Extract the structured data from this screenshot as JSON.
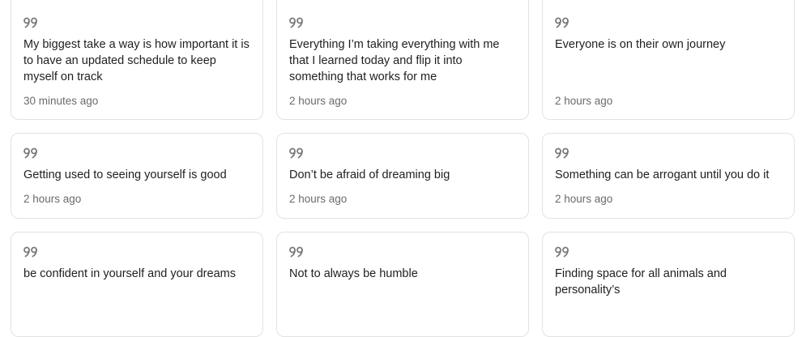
{
  "colors": {
    "card_border": "#e2e2e2",
    "text": "#1f1f1f",
    "muted": "#6b6b6b",
    "quote_icon": "#7a7a7a"
  },
  "cards": [
    {
      "icon": "quote-icon",
      "text": "My biggest take a way is how important it is to have an updated schedule to keep myself on track",
      "time": "30 minutes ago"
    },
    {
      "icon": "quote-icon",
      "text": "Everything I’m taking everything with me that I learned today and flip it into something that works for me",
      "time": "2 hours ago"
    },
    {
      "icon": "quote-icon",
      "text": "Everyone is on their own journey",
      "time": "2 hours ago"
    },
    {
      "icon": "quote-icon",
      "text": "Getting used to seeing yourself is good",
      "time": "2 hours ago"
    },
    {
      "icon": "quote-icon",
      "text": "Don’t be afraid of dreaming big",
      "time": "2 hours ago"
    },
    {
      "icon": "quote-icon",
      "text": "Something can be arrogant until you do it",
      "time": "2 hours ago"
    },
    {
      "icon": "quote-icon",
      "text": "be confident in yourself and your dreams",
      "time": ""
    },
    {
      "icon": "quote-icon",
      "text": "Not to always be humble",
      "time": ""
    },
    {
      "icon": "quote-icon",
      "text": "Finding space for all animals and personality’s",
      "time": ""
    }
  ]
}
